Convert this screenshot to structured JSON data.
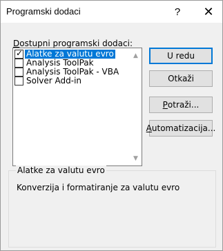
{
  "window": {
    "title": "Programski dodaci",
    "help_label": "?",
    "close_label": "✕"
  },
  "addins": {
    "label_accel": "D",
    "label_rest": "ostupni programski dodaci:",
    "items": [
      {
        "label": "Alatke za valutu evro",
        "checked": true,
        "selected": true
      },
      {
        "label": "Analysis ToolPak",
        "checked": false,
        "selected": false
      },
      {
        "label": "Analysis ToolPak - VBA",
        "checked": false,
        "selected": false
      },
      {
        "label": "Solver Add-in",
        "checked": false,
        "selected": false
      }
    ]
  },
  "buttons": {
    "ok": "U redu",
    "cancel": "Otkaži",
    "browse_accel": "P",
    "browse_rest": "otraži...",
    "automation_accel": "A",
    "automation_rest": "utomatizacija..."
  },
  "description": {
    "title": "Alatke za valutu evro",
    "text": "Konverzija i formatiranje za valutu evro"
  },
  "colors": {
    "selection": "#0078d7",
    "default_button_border": "#0078d7"
  },
  "icons": {
    "checkmark": "✓",
    "scroll_up": "▲",
    "scroll_down": "▼"
  }
}
